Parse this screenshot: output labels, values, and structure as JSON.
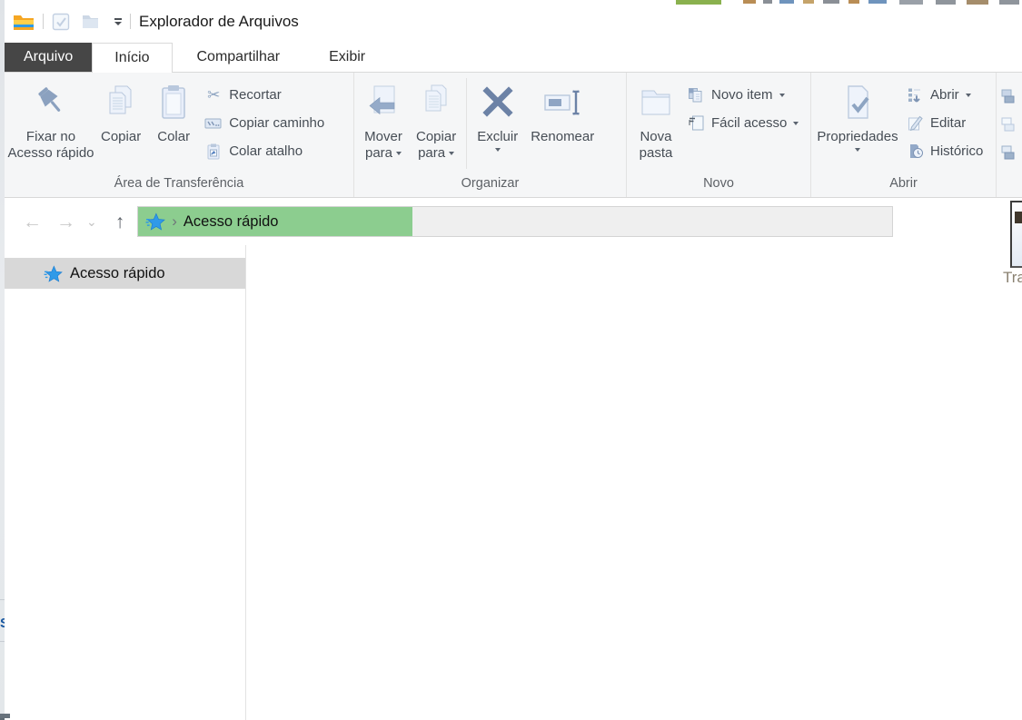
{
  "window": {
    "title": "Explorador de Arquivos"
  },
  "icons": {
    "back_arrow": "←",
    "forward_arrow": "→",
    "recent_chevron": "⌄",
    "up_arrow": "↑",
    "breadcrumb_chevron": "›",
    "scissors": "✂"
  },
  "colors": {
    "progress_green": "#8ccd8f",
    "file_tab_dark": "#464646",
    "ribbon_background": "#f5f6f7",
    "selected_sidebar_item": "#d8d8d8",
    "icon_steel_blue": "#8da3c0",
    "icon_slate_blue": "#6c82a6",
    "quick_access_star_blue": "#2f9ae8"
  },
  "tabs": [
    {
      "label": "Arquivo"
    },
    {
      "label": "Início"
    },
    {
      "label": "Compartilhar"
    },
    {
      "label": "Exibir"
    }
  ],
  "ribbon": {
    "groups": [
      {
        "label": "Área de Transferência",
        "pin": {
          "line1": "Fixar no",
          "line2": "Acesso rápido"
        },
        "copy": {
          "label": "Copiar"
        },
        "paste": {
          "label": "Colar"
        },
        "cut": {
          "label": "Recortar"
        },
        "copy_path": {
          "label": "Copiar caminho"
        },
        "paste_shortcut": {
          "label": "Colar atalho"
        }
      },
      {
        "label": "Organizar",
        "move_to": {
          "line1": "Mover",
          "line2": "para"
        },
        "copy_to": {
          "line1": "Copiar",
          "line2": "para"
        },
        "delete": {
          "label": "Excluir"
        },
        "rename": {
          "label": "Renomear"
        }
      },
      {
        "label": "Novo",
        "new_folder": {
          "line1": "Nova",
          "line2": "pasta"
        },
        "new_item": {
          "label": "Novo item"
        },
        "easy_access": {
          "label": "Fácil acesso"
        }
      },
      {
        "label": "Abrir",
        "properties": {
          "label": "Propriedades"
        },
        "open": {
          "label": "Abrir"
        },
        "edit": {
          "label": "Editar"
        },
        "history": {
          "label": "Histórico"
        }
      }
    ]
  },
  "navbar": {
    "breadcrumb_root": "Acesso rápido"
  },
  "sidebar": {
    "items": [
      {
        "label": "Acesso rápido",
        "selected": true
      }
    ]
  },
  "fragments": {
    "tooltip_text": "Tra",
    "left_edge_letter": "S"
  }
}
